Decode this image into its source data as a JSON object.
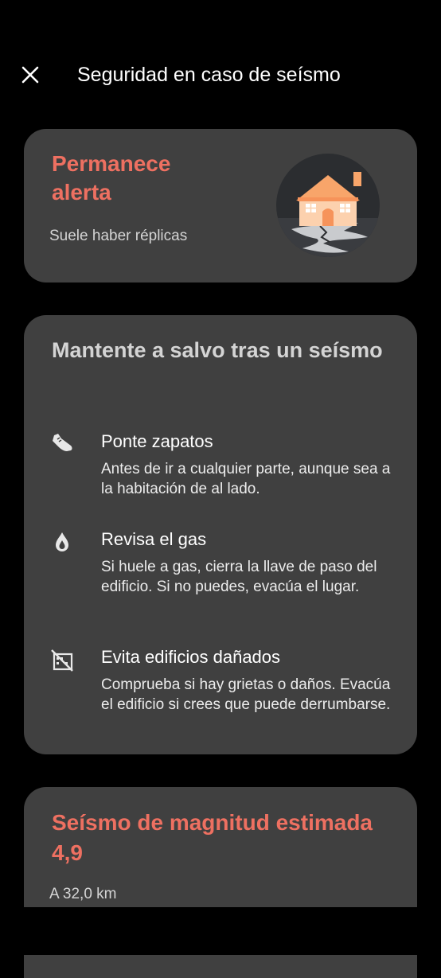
{
  "header": {
    "title": "Seguridad en caso de seísmo",
    "close_icon": "close-icon"
  },
  "alert_card": {
    "title": "Permanece alerta",
    "subtitle": "Suele haber réplicas",
    "illustration": "house-cracked-ground-illustration"
  },
  "safety_card": {
    "title": "Mantente a salvo tras un seísmo",
    "tips": [
      {
        "icon": "shoe-icon",
        "title": "Ponte zapatos",
        "body": "Antes de ir a cualquier parte, aunque sea a la habitación de al lado."
      },
      {
        "icon": "gas-flame-icon",
        "title": "Revisa el gas",
        "body": "Si huele a gas, cierra la llave de paso del edificio. Si no puedes, evacúa el lugar."
      },
      {
        "icon": "damaged-building-icon",
        "title": "Evita edificios dañados",
        "body": "Comprueba si hay grietas o daños. Evacúa el edificio si crees que puede derrumbarse."
      }
    ]
  },
  "quake_card": {
    "title": "Seísmo de magnitud estimada 4,9",
    "distance": "A 32,0 km"
  },
  "colors": {
    "background": "#000000",
    "card": "#404040",
    "accent": "#ee7061",
    "house_orange": "#f8a56a"
  }
}
